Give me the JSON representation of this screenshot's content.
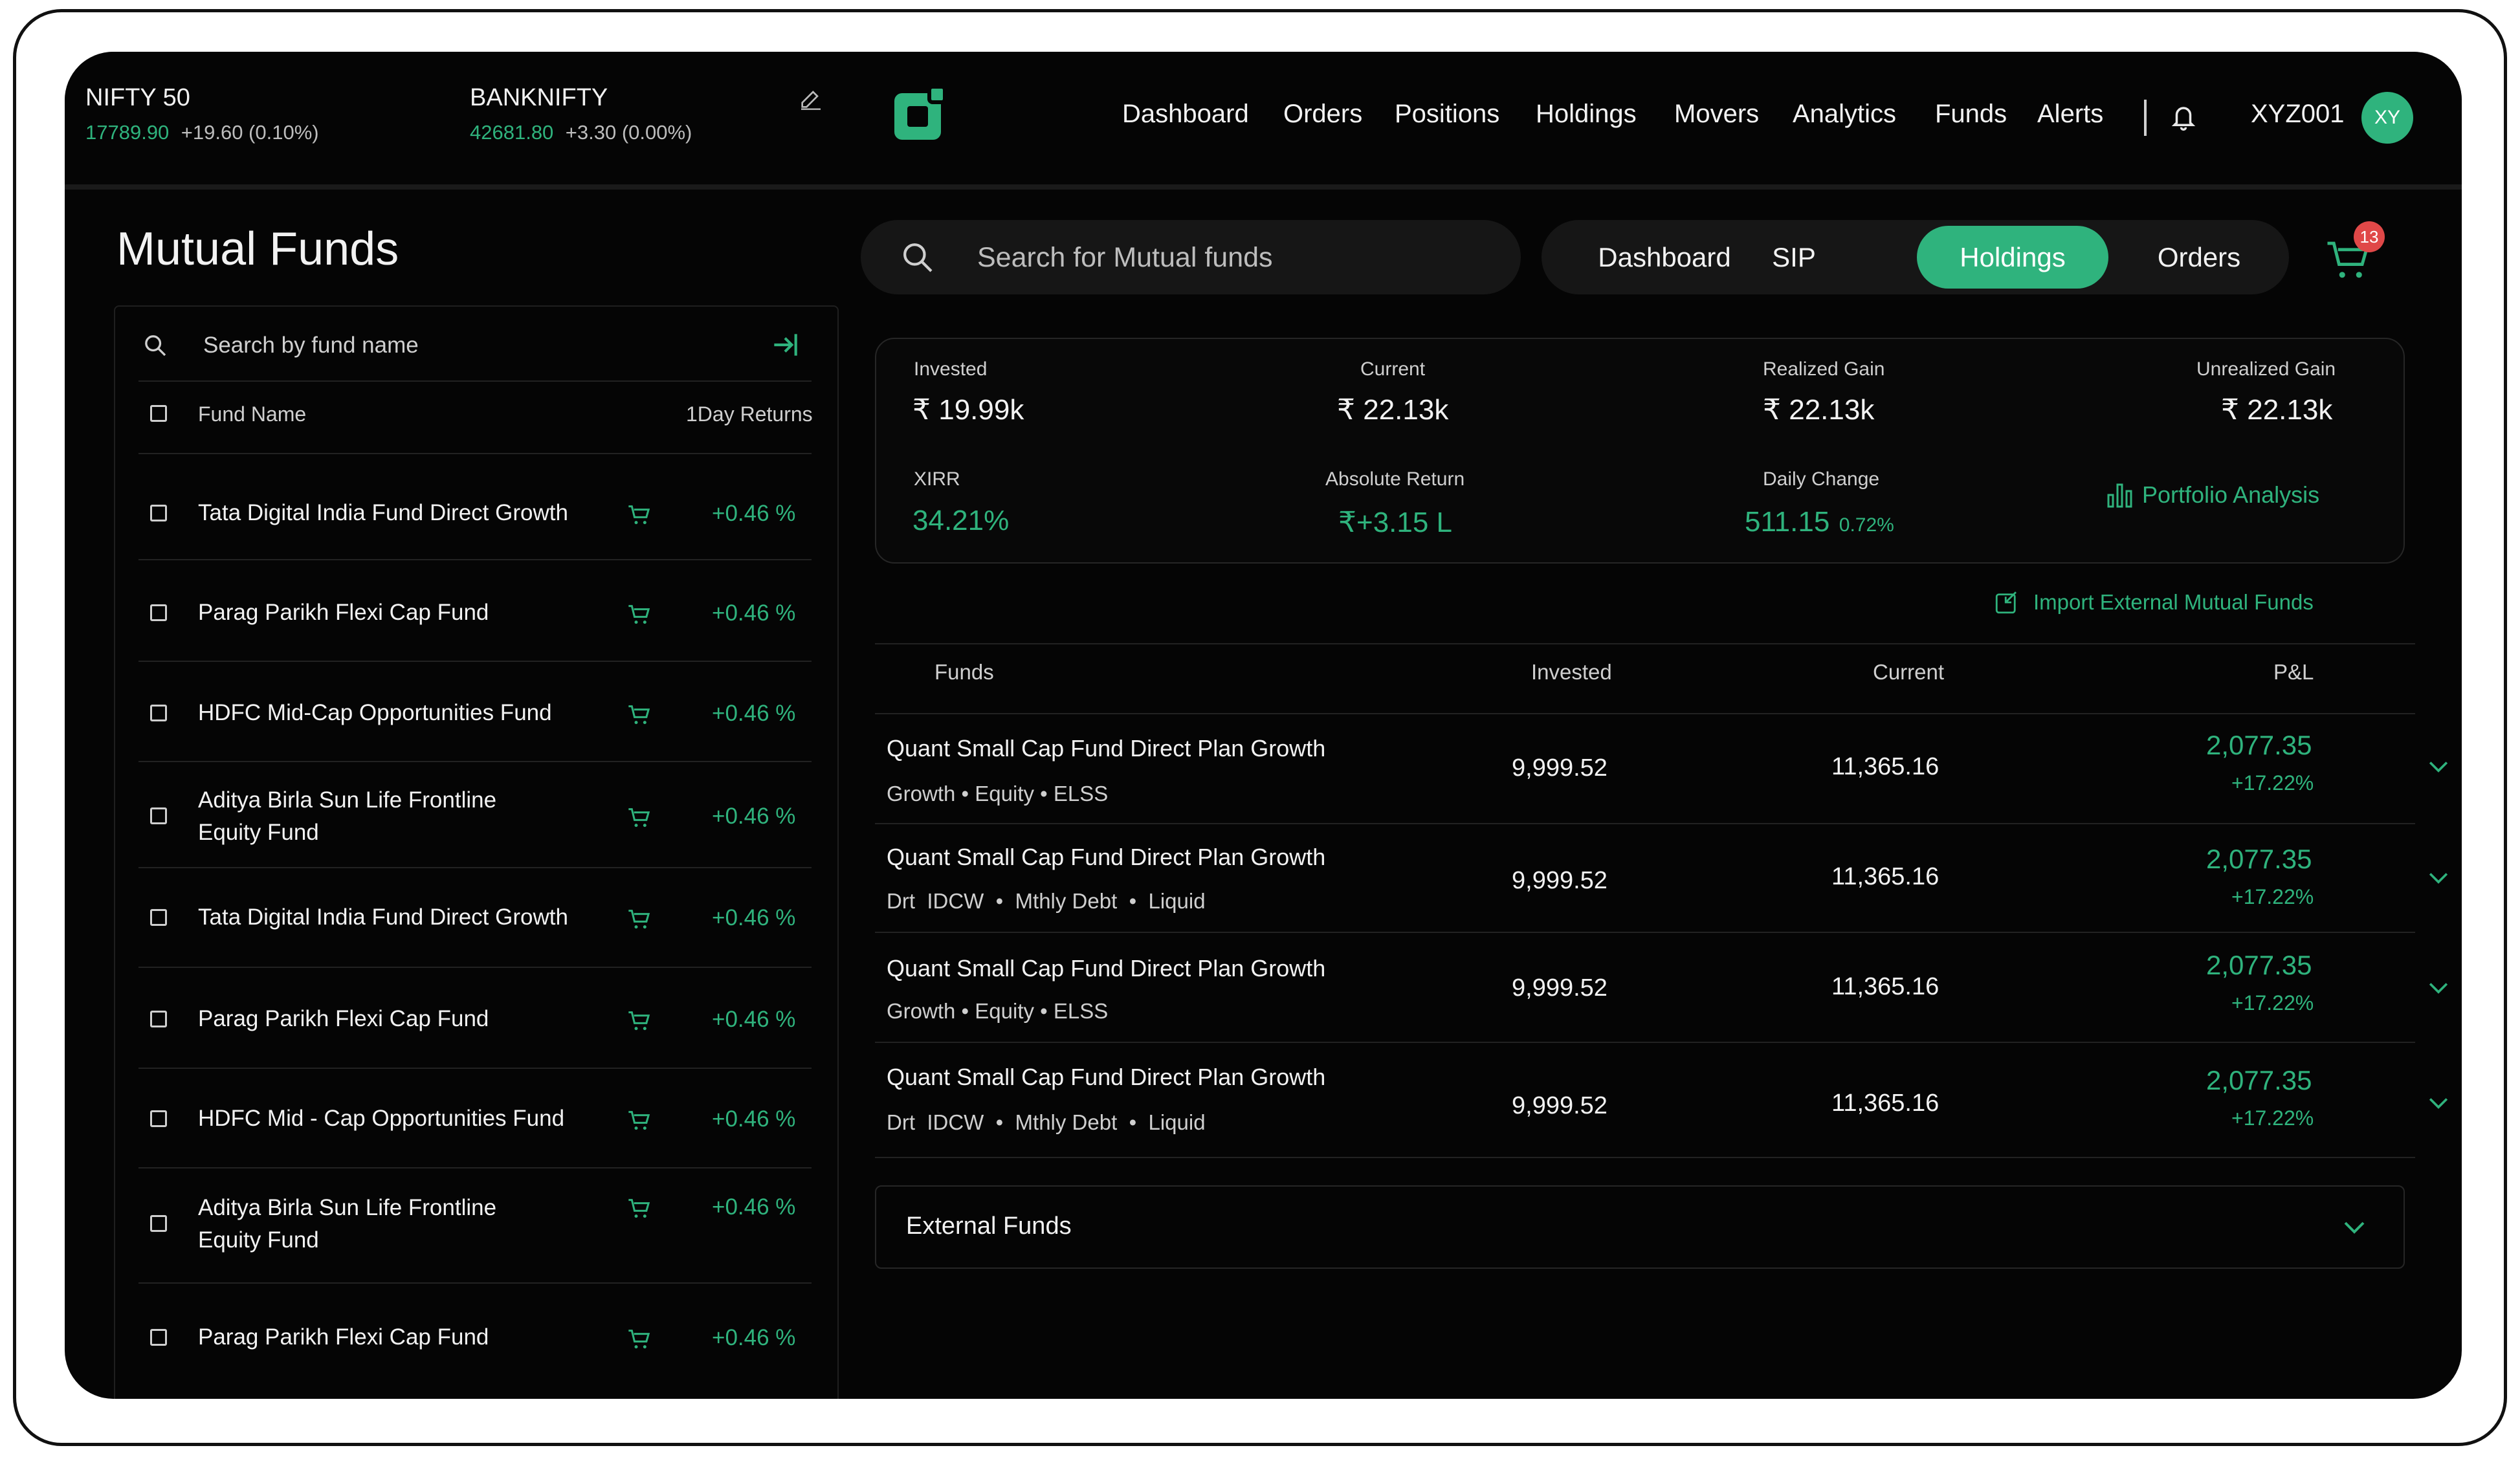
{
  "colors": {
    "accent": "#2fb37d",
    "background": "#050505",
    "badge": "#e04848"
  },
  "tickers": [
    {
      "name": "NIFTY 50",
      "price": "17789.90",
      "change": "+19.60 (0.10%)"
    },
    {
      "name": "BANKNIFTY",
      "price": "42681.80",
      "change": "+3.30 (0.00%)"
    }
  ],
  "nav": {
    "items": [
      "Dashboard",
      "Orders",
      "Positions",
      "Holdings",
      "Movers",
      "Analytics",
      "Funds",
      "Alerts"
    ],
    "user_id": "XYZ001",
    "avatar_initials": "XY"
  },
  "left": {
    "title": "Mutual Funds",
    "search_placeholder": "Search by fund name",
    "col_name": "Fund Name",
    "col_returns": "1Day Returns",
    "funds": [
      {
        "name_line1": "Tata Digital India Fund Direct Growth",
        "name_line2": "",
        "ret": "+0.46 %"
      },
      {
        "name_line1": "Parag Parikh Flexi Cap Fund",
        "name_line2": "",
        "ret": "+0.46 %"
      },
      {
        "name_line1": "HDFC Mid-Cap Opportunities Fund",
        "name_line2": "",
        "ret": "+0.46 %"
      },
      {
        "name_line1": "Aditya Birla Sun Life Frontline",
        "name_line2": "Equity Fund",
        "ret": "+0.46 %"
      },
      {
        "name_line1": "Tata Digital India Fund Direct Growth",
        "name_line2": "",
        "ret": "+0.46 %"
      },
      {
        "name_line1": "Parag Parikh Flexi Cap Fund",
        "name_line2": "",
        "ret": "+0.46 %"
      },
      {
        "name_line1": "HDFC Mid - Cap Opportunities Fund",
        "name_line2": "",
        "ret": "+0.46 %"
      },
      {
        "name_line1": "Aditya Birla Sun Life Frontline",
        "name_line2": "Equity Fund",
        "ret": "+0.46 %"
      },
      {
        "name_line1": "Parag Parikh Flexi Cap Fund",
        "name_line2": "",
        "ret": "+0.46 %"
      }
    ]
  },
  "main": {
    "search_placeholder": "Search for Mutual funds",
    "tabs": [
      "Dashboard",
      "SIP",
      "Holdings",
      "Orders"
    ],
    "active_tab": "Holdings",
    "cart_count": "13",
    "summary": {
      "invested_label": "Invested",
      "invested": "₹ 19.99k",
      "current_label": "Current",
      "current": "₹ 22.13k",
      "realized_label": "Realized Gain",
      "realized": "₹ 22.13k",
      "unrealized_label": "Unrealized Gain",
      "unrealized": "₹ 22.13k",
      "xirr_label": "XIRR",
      "xirr": "34.21%",
      "abs_label": "Absolute Return",
      "abs": "₹+3.15 L",
      "daily_label": "Daily Change",
      "daily": "511.15",
      "daily_pct": "0.72%",
      "portfolio_link": "Portfolio Analysis"
    },
    "import_link": "Import External Mutual Funds",
    "table_headers": {
      "funds": "Funds",
      "invested": "Invested",
      "current": "Current",
      "pl": "P&L"
    },
    "holdings": [
      {
        "name": "Quant Small Cap Fund Direct Plan Growth",
        "tags": [
          "Growth",
          "Equity",
          "ELSS"
        ],
        "invested": "9,999.52",
        "current": "11,365.16",
        "pl": "2,077.35",
        "pl_pct": "+17.22%"
      },
      {
        "name": "Quant Small Cap Fund Direct Plan Growth",
        "tags": [
          "Drt  IDCW",
          "Mthly Debt",
          "Liquid"
        ],
        "invested": "9,999.52",
        "current": "11,365.16",
        "pl": "2,077.35",
        "pl_pct": "+17.22%"
      },
      {
        "name": "Quant Small Cap Fund Direct Plan Growth",
        "tags": [
          "Growth",
          "Equity",
          "ELSS"
        ],
        "invested": "9,999.52",
        "current": "11,365.16",
        "pl": "2,077.35",
        "pl_pct": "+17.22%"
      },
      {
        "name": "Quant Small Cap Fund Direct Plan Growth",
        "tags": [
          "Drt  IDCW",
          "Mthly Debt",
          "Liquid"
        ],
        "invested": "9,999.52",
        "current": "11,365.16",
        "pl": "2,077.35",
        "pl_pct": "+17.22%"
      }
    ],
    "external_funds_label": "External Funds"
  }
}
